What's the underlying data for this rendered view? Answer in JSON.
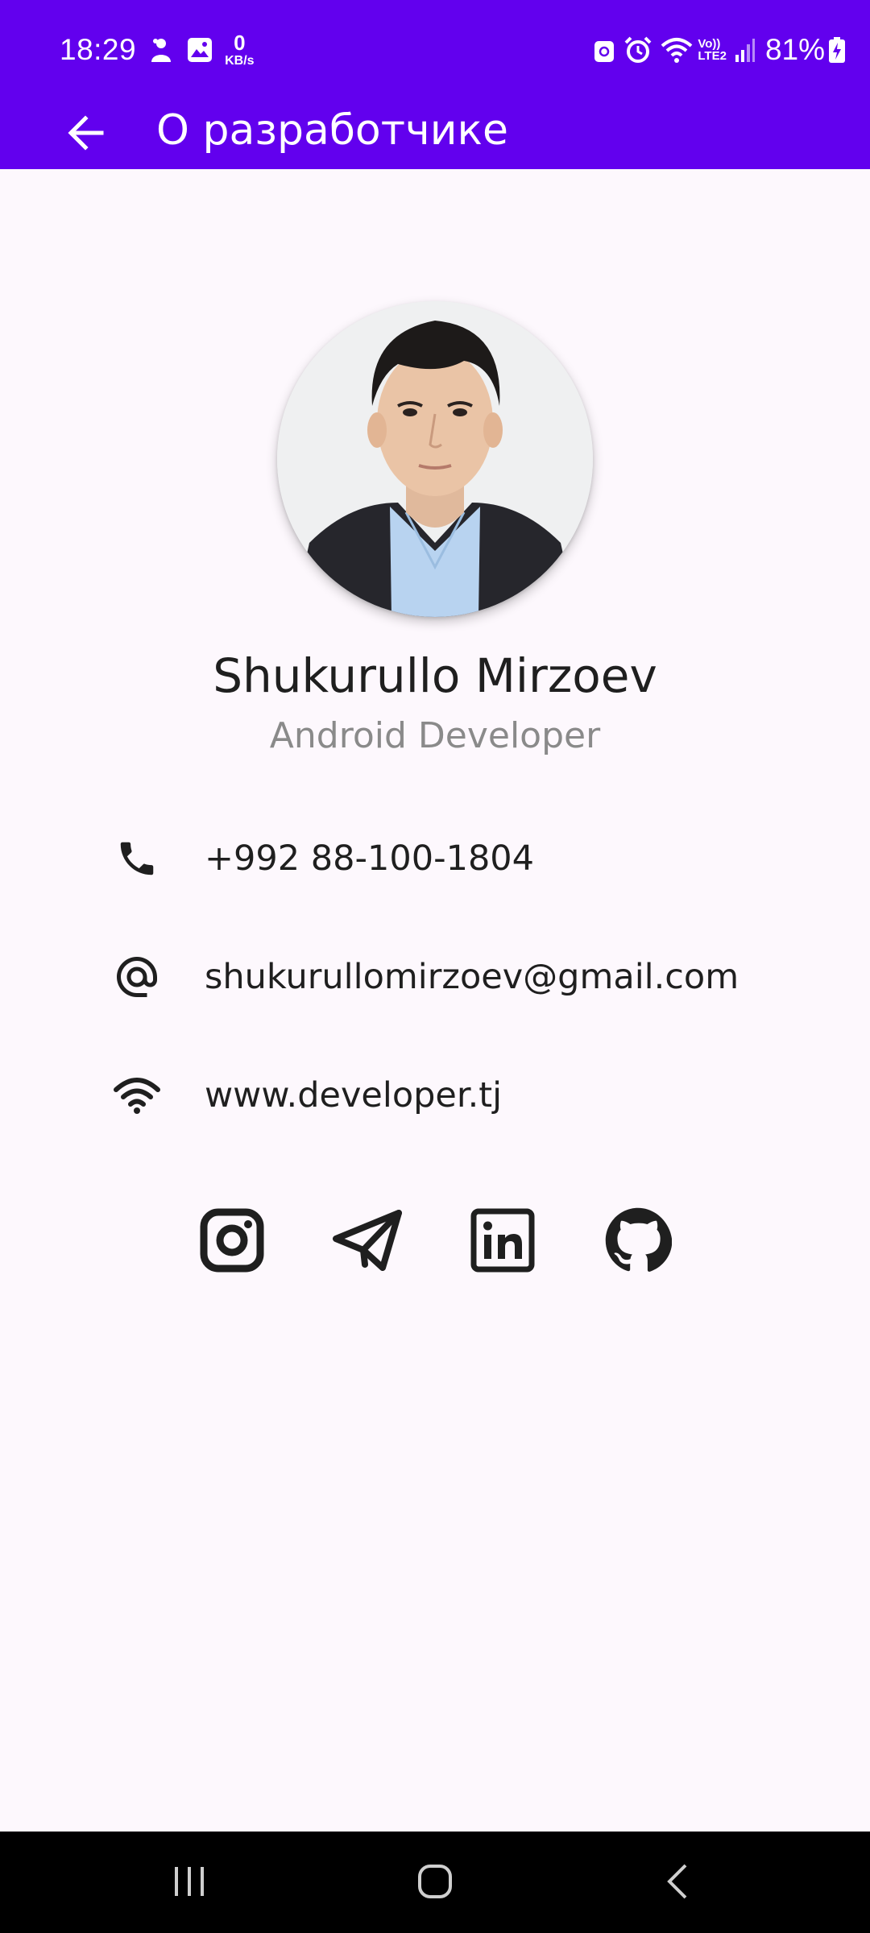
{
  "status_bar": {
    "time": "18:29",
    "net_speed_value": "0",
    "net_speed_unit": "KB/s",
    "volte_label": "Vo))",
    "lte_label": "LTE2",
    "battery": "81%",
    "icons": [
      "person-notification-icon",
      "gallery-notification-icon",
      "smart-lock-icon",
      "alarm-icon",
      "wifi-icon",
      "signal-icon",
      "battery-charging-icon"
    ]
  },
  "app_bar": {
    "title": "О разработчике",
    "back_icon": "arrow-back-icon",
    "color": "#6200ee"
  },
  "profile": {
    "name": "Shukurullo Mirzoev",
    "role": "Android Developer"
  },
  "contacts": [
    {
      "icon": "phone-icon",
      "text": "+992 88-100-1804"
    },
    {
      "icon": "at-sign-icon",
      "text": "shukurullomirzoev@gmail.com"
    },
    {
      "icon": "wifi-icon",
      "text": "www.developer.tj"
    }
  ],
  "socials": [
    "instagram-icon",
    "telegram-icon",
    "linkedin-icon",
    "github-icon"
  ],
  "nav_bar": {
    "buttons": [
      "recent-apps-icon",
      "home-icon",
      "back-icon"
    ]
  }
}
